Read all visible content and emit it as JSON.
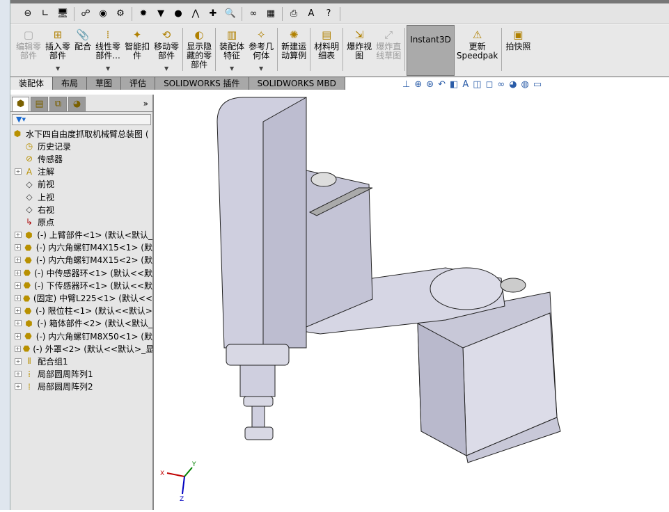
{
  "toolbar_icons": [
    "hole-icon",
    "angle-icon",
    "display-icon",
    "network-icon",
    "globe-icon",
    "gear-icon",
    "gear-dark-icon",
    "funnel-icon",
    "pin-icon",
    "spring-icon",
    "cross-icon",
    "zoom-icon",
    "binoculars-icon",
    "excel-icon",
    "print-icon",
    "text-icon",
    "help-icon"
  ],
  "command_manager": [
    {
      "label": "编辑零\n部件",
      "icon": "edit-component-icon",
      "disabled": true
    },
    {
      "label": "插入零\n部件",
      "icon": "insert-component-icon",
      "dropdown": true
    },
    {
      "label": "配合",
      "icon": "mate-icon"
    },
    {
      "label": "线性零\n部件...",
      "icon": "linear-pattern-icon",
      "dropdown": true
    },
    {
      "label": "智能扣\n件",
      "icon": "smart-fastener-icon"
    },
    {
      "label": "移动零\n部件",
      "icon": "move-component-icon",
      "dropdown": true
    },
    {
      "label": "显示隐\n藏的零\n部件",
      "icon": "show-hidden-icon",
      "sep_before": true
    },
    {
      "label": "装配体\n特征",
      "icon": "assembly-feature-icon",
      "dropdown": true,
      "sep_before": true
    },
    {
      "label": "参考几\n何体",
      "icon": "reference-geometry-icon",
      "dropdown": true
    },
    {
      "label": "新建运\n动算例",
      "icon": "motion-study-icon",
      "sep_before": true
    },
    {
      "label": "材料明\n细表",
      "icon": "bom-icon",
      "sep_before": true
    },
    {
      "label": "爆炸视\n图",
      "icon": "exploded-view-icon",
      "sep_before": true
    },
    {
      "label": "爆炸直\n线草图",
      "icon": "explode-line-icon",
      "disabled": true
    },
    {
      "label": "Instant3D",
      "icon": "instant3d-icon",
      "active": true,
      "sep_before": true
    },
    {
      "label": "更新\nSpeedpak",
      "icon": "speedpak-icon"
    },
    {
      "label": "拍快照",
      "icon": "snapshot-icon",
      "sep_before": true
    }
  ],
  "tabs": [
    {
      "label": "装配体",
      "active": true
    },
    {
      "label": "布局"
    },
    {
      "label": "草图"
    },
    {
      "label": "评估"
    },
    {
      "label": "SOLIDWORKS 插件"
    },
    {
      "label": "SOLIDWORKS MBD"
    }
  ],
  "view_tools": [
    "view-normal-icon",
    "zoom-fit-icon",
    "zoom-area-icon",
    "previous-view-icon",
    "section-view-icon",
    "dynamic-annotation-icon",
    "view-orientation-icon",
    "display-style-icon",
    "hide-show-icon",
    "appearance-icon",
    "scene-icon",
    "view-settings-icon"
  ],
  "panel": {
    "tabs": [
      "feature-manager-icon",
      "property-manager-icon",
      "configuration-manager-icon",
      "display-manager-icon"
    ],
    "more": "»"
  },
  "tree": [
    {
      "label": "水下四自由度抓取机械臂总装图 (",
      "icon": "assembly-icon",
      "root": true
    },
    {
      "label": "历史记录",
      "icon": "history-icon"
    },
    {
      "label": "传感器",
      "icon": "sensor-icon"
    },
    {
      "label": "注解",
      "icon": "annotation-icon",
      "expand": true
    },
    {
      "label": "前视",
      "icon": "plane-icon"
    },
    {
      "label": "上视",
      "icon": "plane-icon"
    },
    {
      "label": "右视",
      "icon": "plane-icon"
    },
    {
      "label": "原点",
      "icon": "origin-icon"
    },
    {
      "label": "(-) 上臂部件<1> (默认<默认_",
      "icon": "subassembly-icon",
      "expand": true
    },
    {
      "label": "(-) 内六角螺钉M4X15<1> (默",
      "icon": "part-icon",
      "expand": true
    },
    {
      "label": "(-) 内六角螺钉M4X15<2> (默",
      "icon": "part-icon",
      "expand": true
    },
    {
      "label": "(-) 中传感器环<1> (默认<<默",
      "icon": "part-icon",
      "expand": true
    },
    {
      "label": "(-) 下传感器环<1> (默认<<默",
      "icon": "part-icon",
      "expand": true
    },
    {
      "label": "(固定) 中臂L225<1> (默认<<",
      "icon": "part-icon",
      "expand": true
    },
    {
      "label": "(-) 限位柱<1> (默认<<默认>",
      "icon": "part-icon",
      "expand": true
    },
    {
      "label": "(-) 箱体部件<2> (默认<默认_",
      "icon": "subassembly-icon",
      "expand": true
    },
    {
      "label": "(-) 内六角螺钉M8X50<1> (默",
      "icon": "part-icon",
      "expand": true
    },
    {
      "label": "(-) 外罩<2> (默认<<默认>_显",
      "icon": "part-icon",
      "expand": true
    },
    {
      "label": "配合组1",
      "icon": "mates-icon",
      "expand": true
    },
    {
      "label": "局部圆周阵列1",
      "icon": "pattern-icon",
      "expand": true
    },
    {
      "label": "局部圆周阵列2",
      "icon": "pattern-icon",
      "expand": true
    }
  ],
  "triad": {
    "x": "X",
    "y": "Y",
    "z": "Z"
  },
  "colors": {
    "model_fill": "#d2d2e0",
    "edge": "#222222",
    "x_axis": "#c00000",
    "y_axis": "#008000",
    "z_axis": "#0000c0"
  }
}
